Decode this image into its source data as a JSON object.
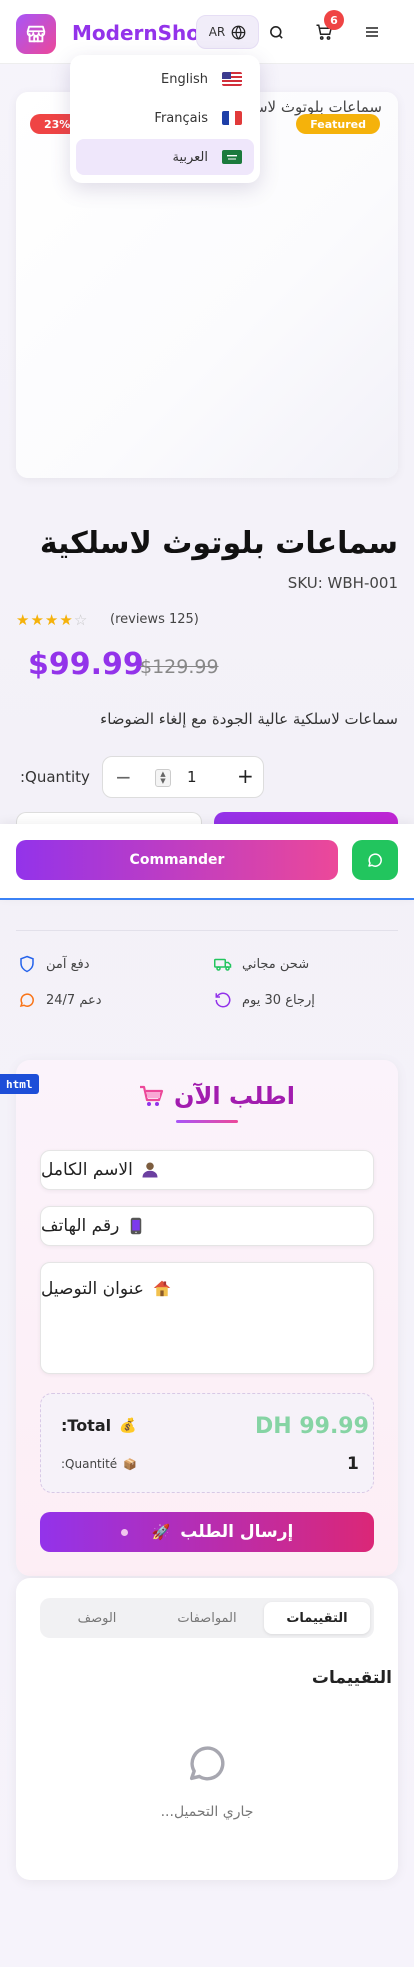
{
  "header": {
    "brand": "ModernShop",
    "lang_code": "AR",
    "cart_count": "6",
    "icons": [
      "store-icon",
      "globe-icon",
      "search-icon",
      "cart-icon",
      "menu-icon"
    ]
  },
  "language_menu": {
    "items": [
      {
        "label": "English",
        "flag": "us"
      },
      {
        "label": "Français",
        "flag": "fr"
      },
      {
        "label": "العربية",
        "flag": "sa",
        "active": true
      }
    ]
  },
  "product": {
    "image_alt": "سماعات بلوتوث لاسلكية",
    "discount_badge": "23%",
    "featured_badge": "Featured",
    "title": "سماعات بلوتوث لاسلكية",
    "sku": "SKU: WBH-001",
    "rating": 4,
    "rating_max": 5,
    "reviews_text": "(reviews 125)",
    "price": "$99.99",
    "old_price": "$129.99",
    "description": "سماعات لاسلكية عالية الجودة مع إلغاء الضوضاء",
    "quantity_label": ":Quantity",
    "quantity_value": "1"
  },
  "sticky_bar": {
    "commander_label": "Commander"
  },
  "features": {
    "free_shipping": "شحن مجاني",
    "secure_payment": "دفع آمن",
    "returns": "إرجاع 30 يوم",
    "support": "دعم 24/7"
  },
  "order_form": {
    "debug_tag": "html",
    "title": "اطلب الآن",
    "name_placeholder": "الاسم الكامل",
    "phone_placeholder": "رقم الهاتف",
    "address_placeholder": "عنوان التوصيل",
    "total_amount": "DH 99.99",
    "total_label": ":Total",
    "quantity_value": "1",
    "quantity_label": ":Quantité",
    "submit_label": "إرسال الطلب"
  },
  "tabs": {
    "items": [
      "التقييمات",
      "المواصفات",
      "الوصف"
    ],
    "active_index": 0,
    "section_title": "التقييمات",
    "loading_text": "...جاري التحميل"
  },
  "colors": {
    "brand": "#9333ea",
    "accent_pink": "#ec4899",
    "whatsapp": "#22c55e",
    "total_green": "#86d4a4",
    "badge_red": "#ef4444",
    "badge_yellow": "#f5b20b"
  }
}
